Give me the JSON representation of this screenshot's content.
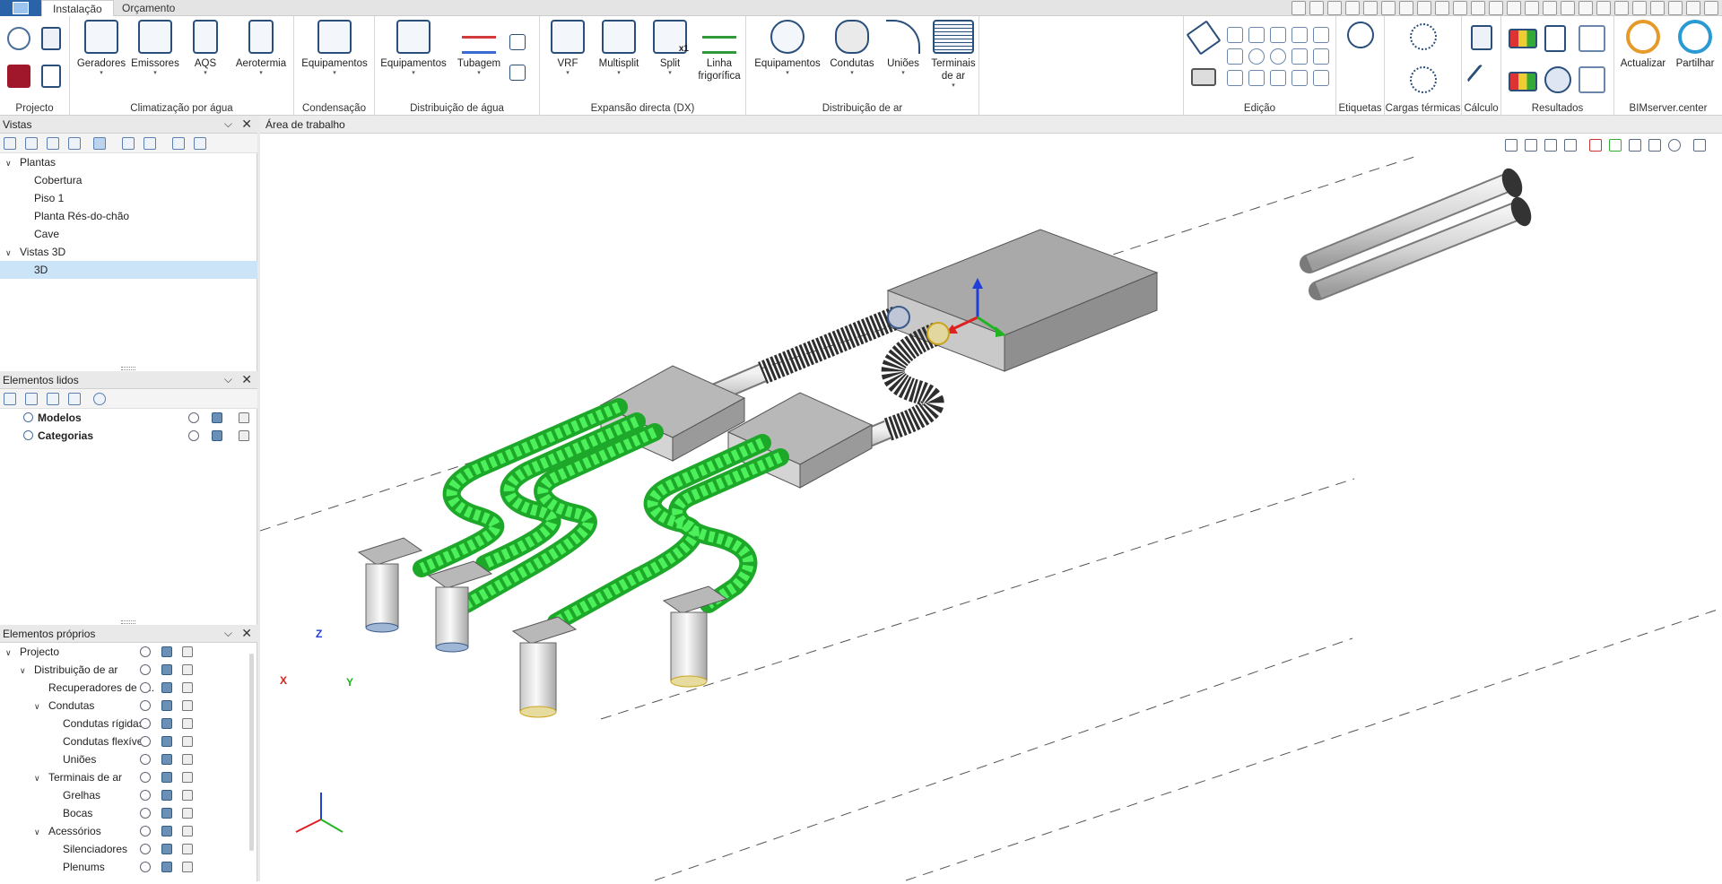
{
  "tabs": [
    "Instalação",
    "Orçamento"
  ],
  "ribbon": {
    "groups": [
      {
        "label": "Projecto"
      },
      {
        "label": "Climatização por água",
        "buttons": [
          "Geradores",
          "Emissores",
          "AQS",
          "Aerotermia"
        ]
      },
      {
        "label": "Condensação",
        "buttons": [
          "Equipamentos"
        ]
      },
      {
        "label": "Distribuição de água",
        "buttons": [
          "Equipamentos",
          "Tubagem"
        ]
      },
      {
        "label": "Expansão directa (DX)",
        "buttons": [
          "VRF",
          "Multisplit",
          "Split"
        ],
        "linha": [
          "Linha",
          "frigorífica"
        ]
      },
      {
        "label": "Distribuição de ar",
        "buttons": [
          "Equipamentos",
          "Condutas",
          "Uniões"
        ],
        "terminais": [
          "Terminais",
          "de ar"
        ]
      },
      {
        "label": "Edição"
      },
      {
        "label": "Etiquetas"
      },
      {
        "label": "Cargas térmicas"
      },
      {
        "label": "Cálculo"
      },
      {
        "label": "Resultados"
      },
      {
        "label": "BIMserver.center",
        "buttons": [
          "Actualizar",
          "Partilhar"
        ]
      }
    ],
    "split_badge": "x1"
  },
  "vistas": {
    "title": "Vistas",
    "tree": [
      {
        "label": "Plantas",
        "level": 0,
        "expanded": true
      },
      {
        "label": "Cobertura",
        "level": 1
      },
      {
        "label": "Piso 1",
        "level": 1
      },
      {
        "label": "Planta Rés-do-chão",
        "level": 1
      },
      {
        "label": "Cave",
        "level": 1
      },
      {
        "label": "Vistas 3D",
        "level": 0,
        "expanded": true
      },
      {
        "label": "3D",
        "level": 1,
        "selected": true
      }
    ]
  },
  "lidos": {
    "title": "Elementos lidos",
    "items": [
      {
        "label": "Modelos"
      },
      {
        "label": "Categorias"
      }
    ]
  },
  "proprios": {
    "title": "Elementos próprios",
    "tree": [
      {
        "label": "Projecto",
        "level": 0,
        "expanded": true
      },
      {
        "label": "Distribuição de ar",
        "level": 1,
        "expanded": true
      },
      {
        "label": "Recuperadores de c...",
        "level": 2
      },
      {
        "label": "Condutas",
        "level": 2,
        "expanded": true
      },
      {
        "label": "Condutas rígidas",
        "level": 3
      },
      {
        "label": "Condutas flexíveis",
        "level": 3
      },
      {
        "label": "Uniões",
        "level": 3
      },
      {
        "label": "Terminais de ar",
        "level": 2,
        "expanded": true
      },
      {
        "label": "Grelhas",
        "level": 3
      },
      {
        "label": "Bocas",
        "level": 3
      },
      {
        "label": "Acessórios",
        "level": 2,
        "expanded": true
      },
      {
        "label": "Silenciadores",
        "level": 3
      },
      {
        "label": "Plenums",
        "level": 3
      }
    ]
  },
  "workspace": {
    "title": "Área de trabalho",
    "axes": {
      "x": "X",
      "y": "Y",
      "z": "Z"
    }
  },
  "colors": {
    "accent": "#2a63a8",
    "flex_duct": "#22cc33",
    "selection": "#cce4f7"
  }
}
